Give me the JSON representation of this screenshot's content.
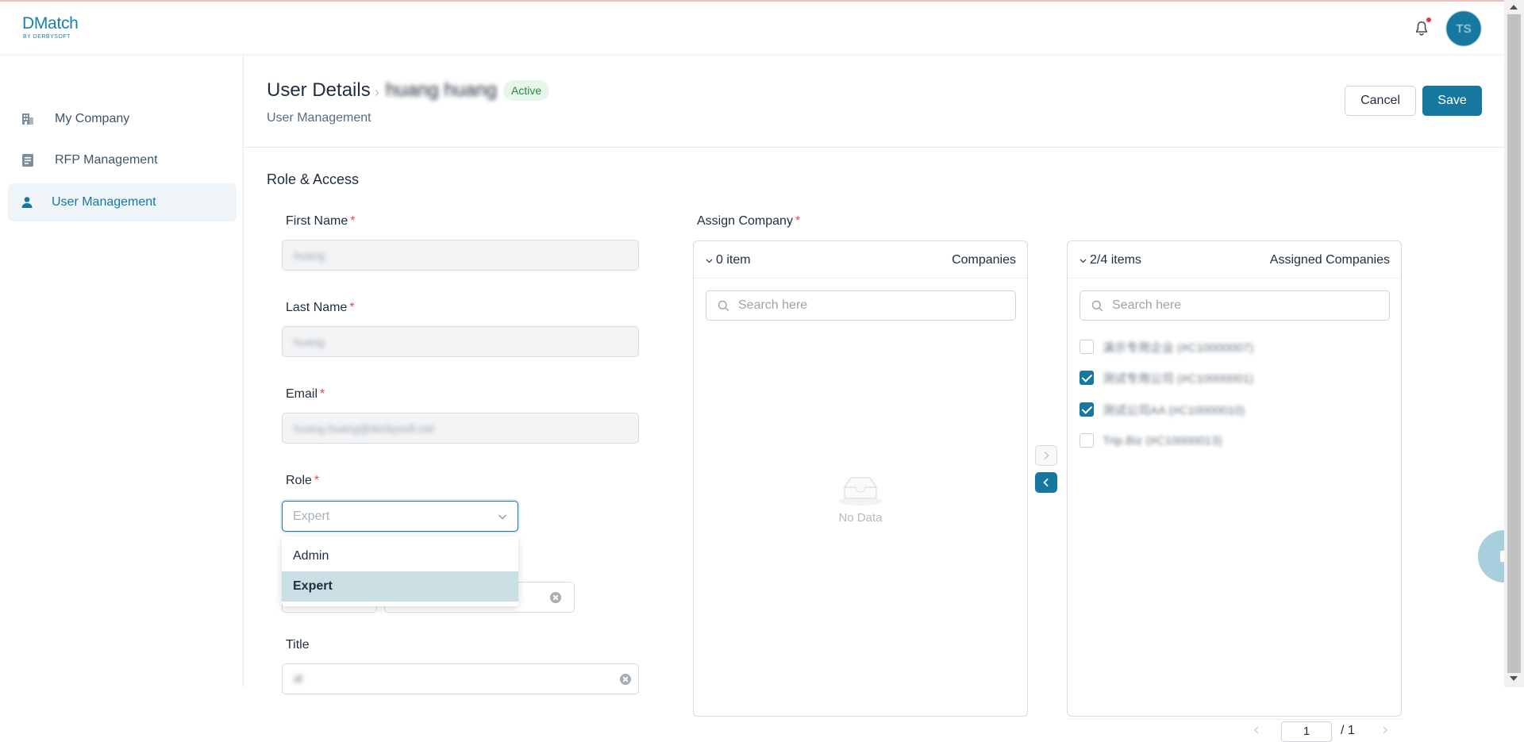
{
  "app": {
    "logo_main": "DMatch",
    "logo_sub": "BY DERBYSOFT",
    "avatar_initials": "TS",
    "accent_color": "#17789f"
  },
  "sidebar": {
    "items": [
      {
        "label": "My Company",
        "icon": "building-icon",
        "active": false
      },
      {
        "label": "RFP Management",
        "icon": "document-icon",
        "active": false
      },
      {
        "label": "User Management",
        "icon": "user-icon",
        "active": true
      }
    ]
  },
  "page": {
    "title": "User Details",
    "separator": "›",
    "user_name": "huang huang",
    "status": "Active",
    "breadcrumb": "User Management",
    "cancel_label": "Cancel",
    "save_label": "Save"
  },
  "form": {
    "section_title": "Role & Access",
    "first_name_label": "First Name",
    "first_name_value": "huang",
    "last_name_label": "Last Name",
    "last_name_value": "huang",
    "email_label": "Email",
    "email_value": "huang.huang@derbysoft.net",
    "role_label": "Role",
    "role_value": "Expert",
    "role_options": [
      "Admin",
      "Expert"
    ],
    "title_label": "Title",
    "title_value": "dl",
    "required_mark": "*"
  },
  "assign": {
    "label": "Assign Company",
    "left": {
      "count": "0 item",
      "title": "Companies",
      "search_placeholder": "Search here",
      "empty_text": "No Data"
    },
    "right": {
      "count": "2/4 items",
      "title": "Assigned Companies",
      "search_placeholder": "Search here",
      "items": [
        {
          "label": "演示专用企业 (#C10000007)",
          "checked": false
        },
        {
          "label": "测试专用公司 (#C10000001)",
          "checked": true
        },
        {
          "label": "测试公司AA (#C10000010)",
          "checked": true
        },
        {
          "label": "Trip.Biz (#C10000013)",
          "checked": false
        }
      ],
      "page_current": "1",
      "page_total": "/ 1"
    }
  }
}
